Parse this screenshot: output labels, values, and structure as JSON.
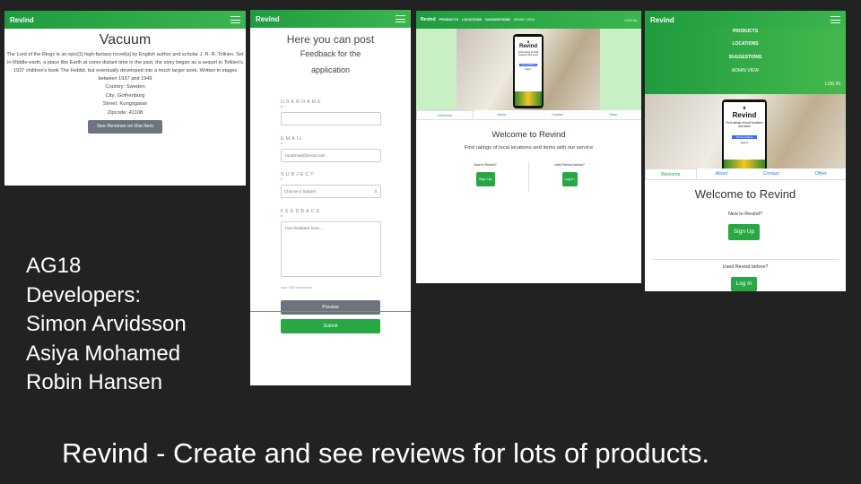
{
  "slide": {
    "team_lines": [
      "AG18",
      "Developers:",
      "Simon Arvidsson",
      "Asiya Mohamed",
      "Robin Hansen"
    ],
    "caption": "Revind - Create and see reviews for lots of products."
  },
  "colors": {
    "background": "#222222",
    "brand_green": "#28a745",
    "link_blue": "#1e7ee8"
  },
  "icons": {
    "menu": "hamburger-icon"
  },
  "screen_item": {
    "brand": "Revind",
    "title": "Vacuum",
    "description": "The Lord of the Rings is an epic[1] high-fantasy novel[a] by English author and scholar J. R. R. Tolkien. Set in Middle-earth, a place like Earth at some distant time in the past, the story began as a sequel to Tolkien's 1937 children's book The Hobbit, but eventually developed into a much larger work. Written in stages between 1937 and 1949",
    "country": "Country: Sweden",
    "city": "City: Gothenburg",
    "street": "Street: Kungsgatan",
    "zipcode": "Zipcode: 41108",
    "reviews_button": "See Reviews on this Item"
  },
  "screen_feedback": {
    "brand": "Revind",
    "heading": "Here you can post",
    "subheading_1": "Feedback for the",
    "subheading_2": "application",
    "username_label": "USERNAME",
    "email_label": "EMAIL",
    "email_placeholder": "YourEmail@email.com",
    "subject_label": "SUBJECT",
    "subject_value": "Choose a Subject",
    "feedback_label": "FEEDBACK",
    "feedback_placeholder": "Your feedback here...",
    "hint": "max 300 characters",
    "required_mark": "*",
    "preview_button": "Preview",
    "submit_button": "Submit"
  },
  "screen_welcome_desktop": {
    "brand": "Revind",
    "nav": [
      "PRODUCTS",
      "LOCATIONS",
      "SUGGESTIONS",
      "ADMIN VIEW"
    ],
    "login": "LOG IN",
    "phone_brand": "Revind",
    "phone_text": "Find ratings of local locations and items",
    "phone_button": "Find locations",
    "phone_login": "Log In",
    "tabs": [
      "Welcome",
      "About",
      "Contact",
      "Other"
    ],
    "title": "Welcome to Revind",
    "subtitle": "Find ratings of local locations and items with our service",
    "new_label": "New to Revind?",
    "signup_button": "Sign Up",
    "used_label": "Used Revind before?",
    "login_button": "Log In"
  },
  "screen_welcome_mobile": {
    "brand": "Revind",
    "menu": [
      "PRODUCTS",
      "LOCATIONS",
      "SUGGESTIONS",
      "ADMIN VIEW"
    ],
    "login": "LOG IN",
    "phone_brand": "Revind",
    "phone_text": "Find ratings of local locations and items",
    "phone_button": "Find locations",
    "phone_login": "Log In",
    "tabs": [
      "Welcome",
      "About",
      "Contact",
      "Other"
    ],
    "title": "Welcome to Revind",
    "new_label": "New to Revind?",
    "signup_button": "Sign Up",
    "used_label": "Used Revind before?",
    "login_button": "Log In"
  }
}
